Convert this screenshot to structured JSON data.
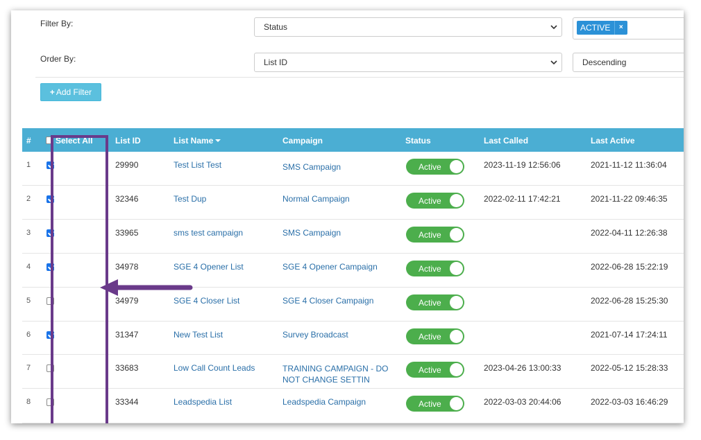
{
  "filters": {
    "filter_by_label": "Filter By:",
    "filter_by_value": "Status",
    "filter_tag": "ACTIVE",
    "order_by_label": "Order By:",
    "order_by_value": "List ID",
    "order_direction": "Descending",
    "add_filter_label": "Add Filter"
  },
  "table": {
    "headers": {
      "num": "#",
      "select_all": "Select All",
      "list_id": "List ID",
      "list_name": "List Name",
      "campaign": "Campaign",
      "status": "Status",
      "last_called": "Last Called",
      "last_active": "Last Active"
    },
    "rows": [
      {
        "num": "1",
        "checked": true,
        "list_id": "29990",
        "list_name": "Test List Test",
        "campaign": "SMS Campaign",
        "status": "Active",
        "last_called": "2023-11-19 12:56:06",
        "last_active": "2021-11-12 11:36:04"
      },
      {
        "num": "2",
        "checked": true,
        "list_id": "32346",
        "list_name": "Test Dup",
        "campaign": "Normal Campaign",
        "status": "Active",
        "last_called": "2022-02-11 17:42:21",
        "last_active": "2021-11-22 09:46:35"
      },
      {
        "num": "3",
        "checked": true,
        "list_id": "33965",
        "list_name": "sms test campaign",
        "campaign": "SMS Campaign",
        "status": "Active",
        "last_called": "",
        "last_active": "2022-04-11 12:26:38"
      },
      {
        "num": "4",
        "checked": true,
        "list_id": "34978",
        "list_name": "SGE 4 Opener List",
        "campaign": "SGE 4 Opener Campaign",
        "status": "Active",
        "last_called": "",
        "last_active": "2022-06-28 15:22:19"
      },
      {
        "num": "5",
        "checked": false,
        "list_id": "34979",
        "list_name": "SGE 4 Closer List",
        "campaign": "SGE 4 Closer Campaign",
        "status": "Active",
        "last_called": "",
        "last_active": "2022-06-28 15:25:30"
      },
      {
        "num": "6",
        "checked": true,
        "list_id": "31347",
        "list_name": "New Test List",
        "campaign": "Survey Broadcast",
        "status": "Active",
        "last_called": "",
        "last_active": "2021-07-14 17:24:11"
      },
      {
        "num": "7",
        "checked": false,
        "list_id": "33683",
        "list_name": "Low Call Count Leads",
        "campaign": "TRAINING CAMPAIGN - DO NOT CHANGE SETTIN",
        "status": "Active",
        "last_called": "2023-04-26 13:00:33",
        "last_active": "2022-05-12 15:28:33"
      },
      {
        "num": "8",
        "checked": false,
        "list_id": "33344",
        "list_name": "Leadspedia List",
        "campaign": "Leadspedia Campaign",
        "status": "Active",
        "last_called": "2022-03-03 20:44:06",
        "last_active": "2022-03-03 16:46:29"
      }
    ]
  },
  "colors": {
    "header": "#4baed3",
    "toggle_active": "#4cae4c",
    "link": "#2a6fa8",
    "annotation": "#6a3a8a",
    "tag": "#2b91d7",
    "button": "#5bc0de"
  },
  "annotation": {
    "type": "arrow",
    "direction": "left"
  }
}
